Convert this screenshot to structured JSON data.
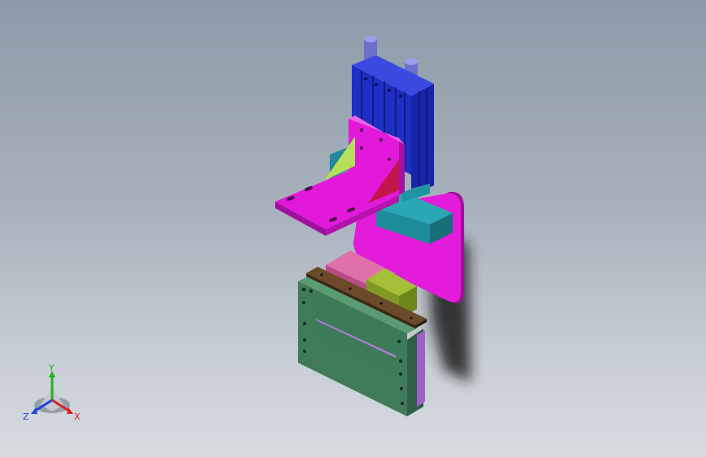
{
  "viewport": {
    "background_top": "#8e9aa8",
    "background_bottom": "#d6dbe0"
  },
  "model": {
    "part_colors": {
      "cylinder_body": "#2233cc",
      "cylinder_rods": "#7a80d8",
      "bracket": "#e61ee0",
      "gusset_left": "#b8e060",
      "gusset_right": "#c0184a",
      "block_teal": "#1f8f9a",
      "base_plate": "#e31cd8",
      "clamp_plate_brown": "#6b4a2a",
      "pink_pad": "#de6fa8",
      "olive_block": "#8da52a",
      "frame_green": "#3f7a58",
      "frame_inner": "#b27bdc"
    }
  },
  "triad": {
    "x_label": "X",
    "y_label": "Y",
    "z_label": "Z",
    "x_color": "#e02020",
    "y_color": "#20b020",
    "z_color": "#2040e0"
  }
}
